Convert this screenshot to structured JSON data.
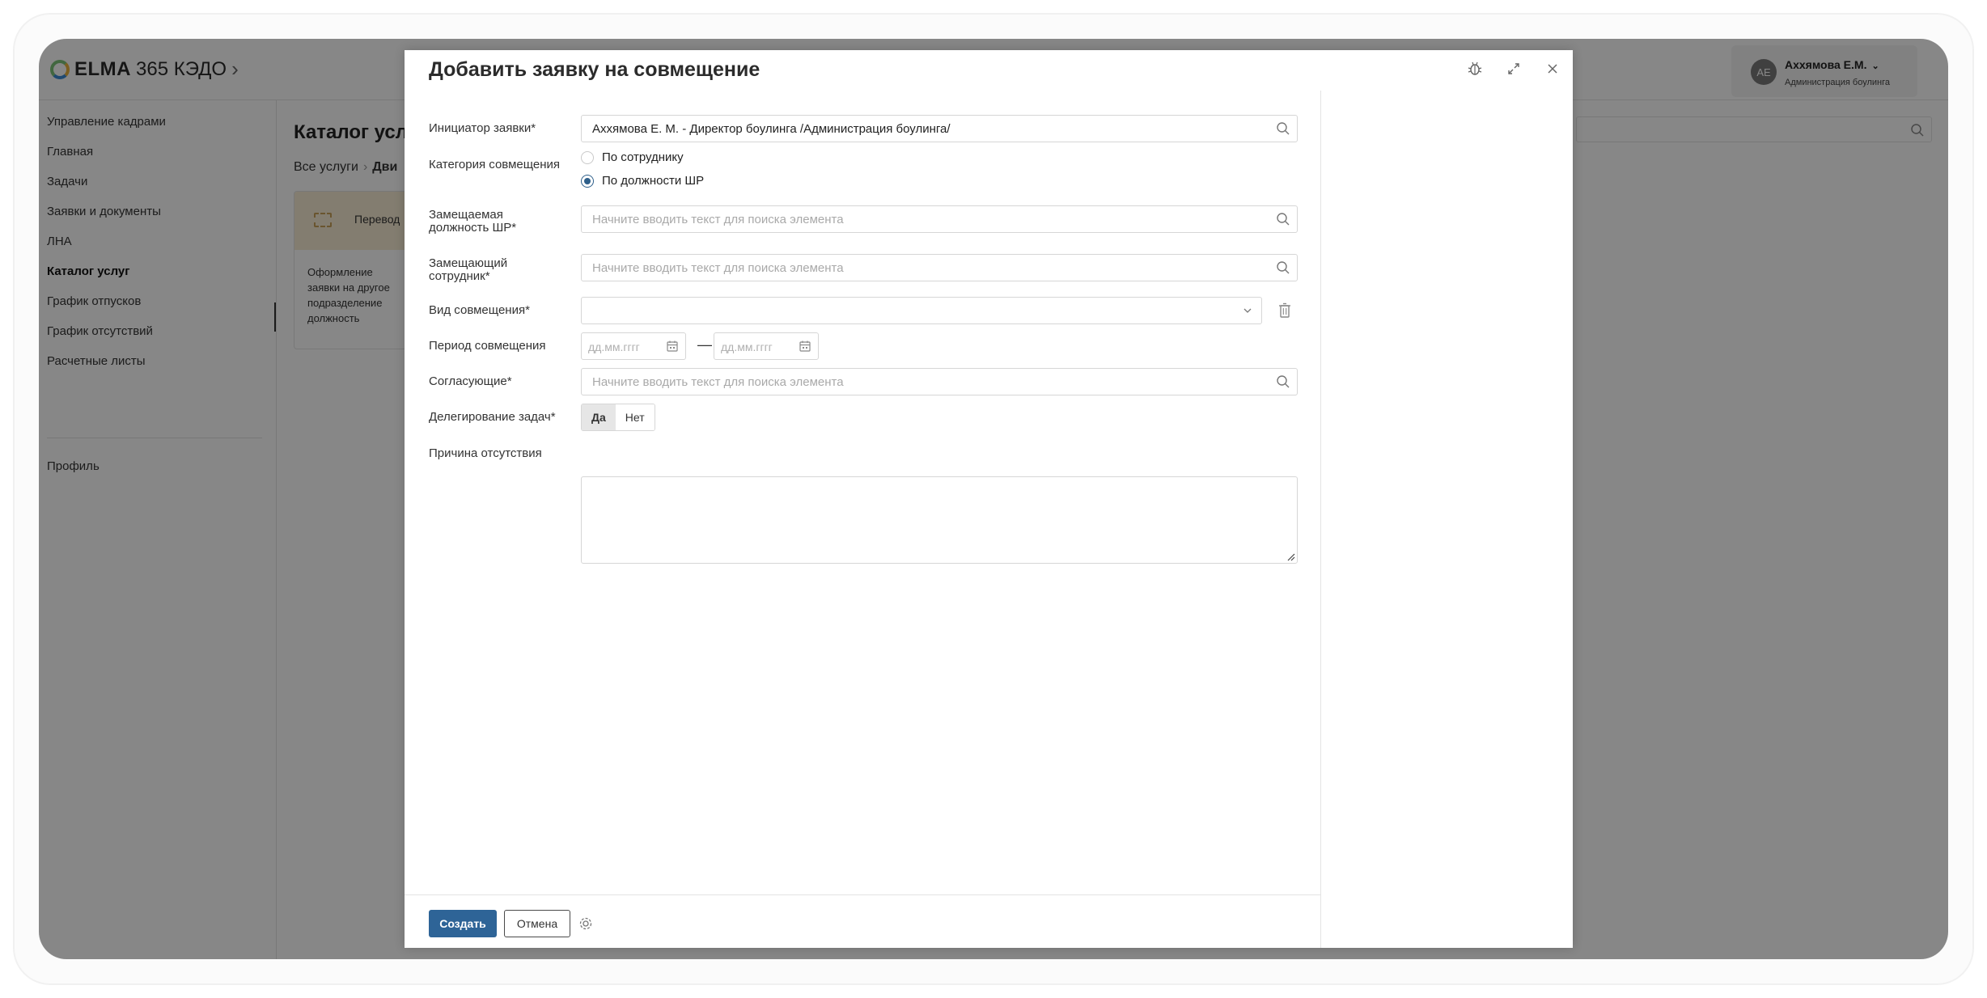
{
  "app": {
    "logo_brand": "ELMA",
    "logo_suffix": "365 КЭДО",
    "logo_chevron": "›",
    "user": {
      "initials": "АЕ",
      "name": "Аххямова Е.М.",
      "role": "Администрация боулинга"
    }
  },
  "sidebar": {
    "items": [
      {
        "label": "Управление кадрами",
        "active": false
      },
      {
        "label": "Главная",
        "active": false
      },
      {
        "label": "Задачи",
        "active": false
      },
      {
        "label": "Заявки и документы",
        "active": false
      },
      {
        "label": "ЛНА",
        "active": false
      },
      {
        "label": "Каталог услуг",
        "active": true
      },
      {
        "label": "График отпусков",
        "active": false
      },
      {
        "label": "График отсутствий",
        "active": false
      },
      {
        "label": "Расчетные листы",
        "active": false
      }
    ],
    "profile_label": "Профиль"
  },
  "main": {
    "title": "Каталог усл",
    "breadcrumb_root": "Все услуги",
    "breadcrumb_sep": "›",
    "breadcrumb_current": "Дви",
    "card_name": "Перевод",
    "card_desc": "Оформление заявки на другое подразделение должность"
  },
  "modal": {
    "title": "Добавить заявку на совмещение",
    "fields": {
      "initiator": {
        "label": "Инициатор заявки*",
        "value": "Аххямова Е. М. - Директор боулинга /Администрация боулинга/"
      },
      "category": {
        "label": "Категория совмещения",
        "options": [
          {
            "label": "По сотруднику",
            "checked": false
          },
          {
            "label": "По должности ШР",
            "checked": true
          }
        ]
      },
      "position": {
        "label": "Замещаемая должность ШР*",
        "placeholder": "Начните вводить текст для поиска элемента"
      },
      "substitute": {
        "label": "Замещающий сотрудник*",
        "placeholder": "Начните вводить текст для поиска элемента"
      },
      "kind": {
        "label": "Вид совмещения*",
        "value": ""
      },
      "period": {
        "label": "Период совмещения",
        "from_placeholder": "дд.мм.гггг",
        "to_placeholder": "дд.мм.гггг",
        "dash": "—"
      },
      "approvers": {
        "label": "Согласующие*",
        "placeholder": "Начните вводить текст для поиска элемента"
      },
      "delegation": {
        "label": "Делегирование задач*",
        "yes": "Да",
        "no": "Нет",
        "selected": "Да"
      },
      "reason": {
        "label": "Причина отсутствия",
        "value": ""
      }
    },
    "footer": {
      "create_label": "Создать",
      "cancel_label": "Отмена"
    }
  },
  "icons": {
    "search": "search-icon",
    "bug": "bug-icon",
    "expand": "expand-icon",
    "close": "close-icon",
    "calendar": "calendar-icon",
    "trash": "trash-icon",
    "gear": "gear-icon",
    "chevron": "chevron-down-icon"
  },
  "colors": {
    "primary": "#2e6497",
    "radio_checked": "#2e5f8a",
    "overlay": "rgba(0,0,0,0.47)"
  }
}
